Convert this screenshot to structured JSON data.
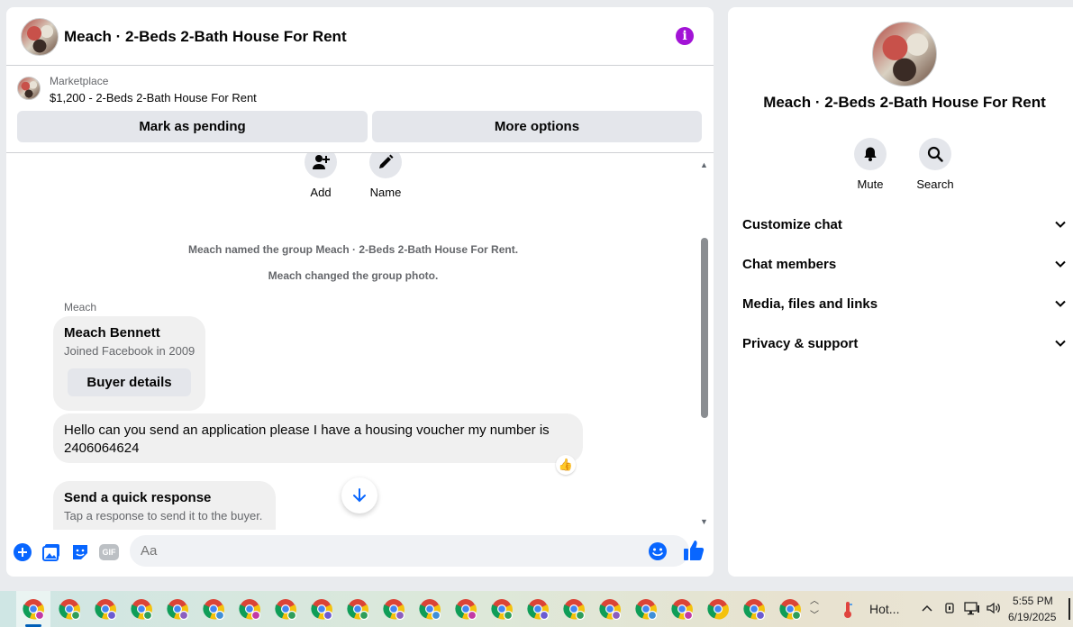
{
  "colors": {
    "accent": "#0866ff",
    "info": "#a213d6",
    "bubble": "#f0f0f0",
    "button": "#e4e6eb"
  },
  "header": {
    "title": "Meach · 2-Beds 2-Bath House For Rent",
    "info_icon": "info-icon"
  },
  "marketplace": {
    "label": "Marketplace",
    "listing": "$1,200 - 2-Beds 2-Bath House For Rent",
    "pending_label": "Mark as pending",
    "options_label": "More options"
  },
  "actions": {
    "add_label": "Add",
    "name_label": "Name"
  },
  "messages": {
    "system": [
      "Meach named the group Meach · 2-Beds 2-Bath House For Rent.",
      "Meach changed the group photo."
    ],
    "sender": "Meach",
    "card": {
      "name": "Meach Bennett",
      "joined": "Joined Facebook in 2009",
      "button": "Buyer details"
    },
    "text": "Hello can you send an application please I have a housing voucher my number is 2406064624",
    "reaction": "👍",
    "quick": {
      "title": "Send a quick response",
      "subtitle": "Tap a response to send it to the buyer."
    }
  },
  "composer": {
    "placeholder": "Aa",
    "gif_label": "GIF"
  },
  "info": {
    "title": "Meach · 2-Beds 2-Bath House For Rent",
    "mute_label": "Mute",
    "search_label": "Search",
    "sections": [
      "Customize chat",
      "Chat members",
      "Media, files and links",
      "Privacy & support"
    ]
  },
  "taskbar": {
    "weather": "Hot...",
    "time": "5:55 PM",
    "date": "6/19/2025",
    "browser_icon_count": 22
  }
}
